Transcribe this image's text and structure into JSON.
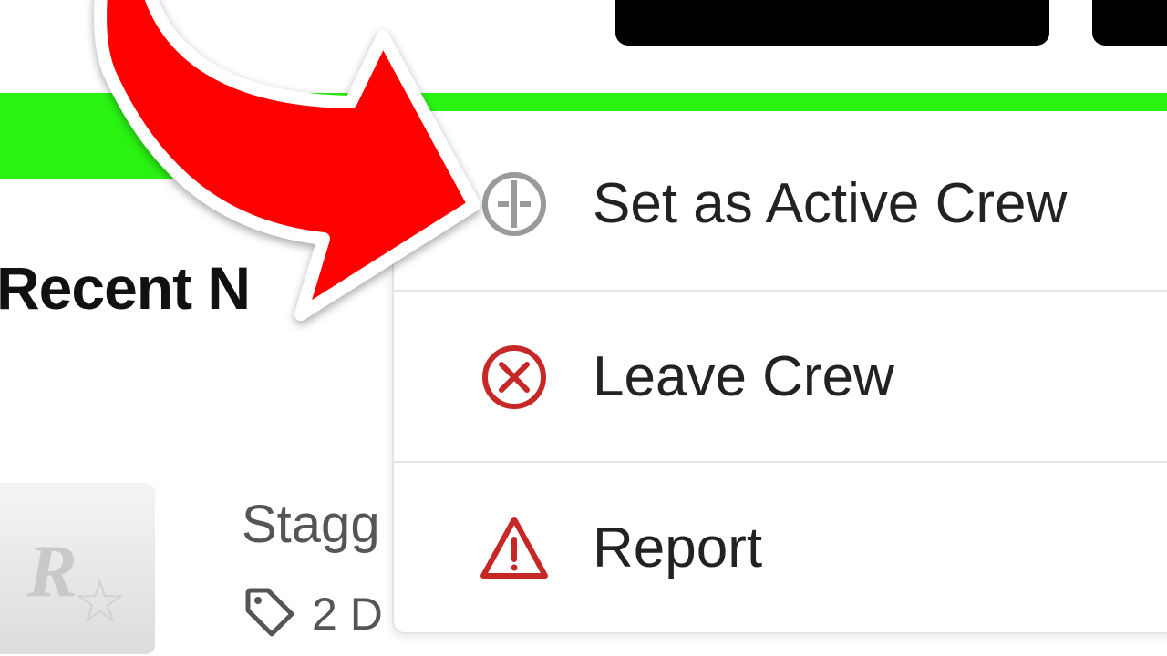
{
  "section": {
    "title": "Recent N"
  },
  "news": {
    "headline": "Stagg",
    "date": "2 D"
  },
  "menu": {
    "items": [
      {
        "label": "Set as Active Crew",
        "icon": "set-active-icon",
        "color": "#9a9a9a"
      },
      {
        "label": "Leave Crew",
        "icon": "leave-icon",
        "color": "#c62828"
      },
      {
        "label": "Report",
        "icon": "warning-icon",
        "color": "#c62828"
      }
    ]
  },
  "colors": {
    "banner": "#2af312",
    "arrow": "#ff0000",
    "top_button": "#000000"
  }
}
